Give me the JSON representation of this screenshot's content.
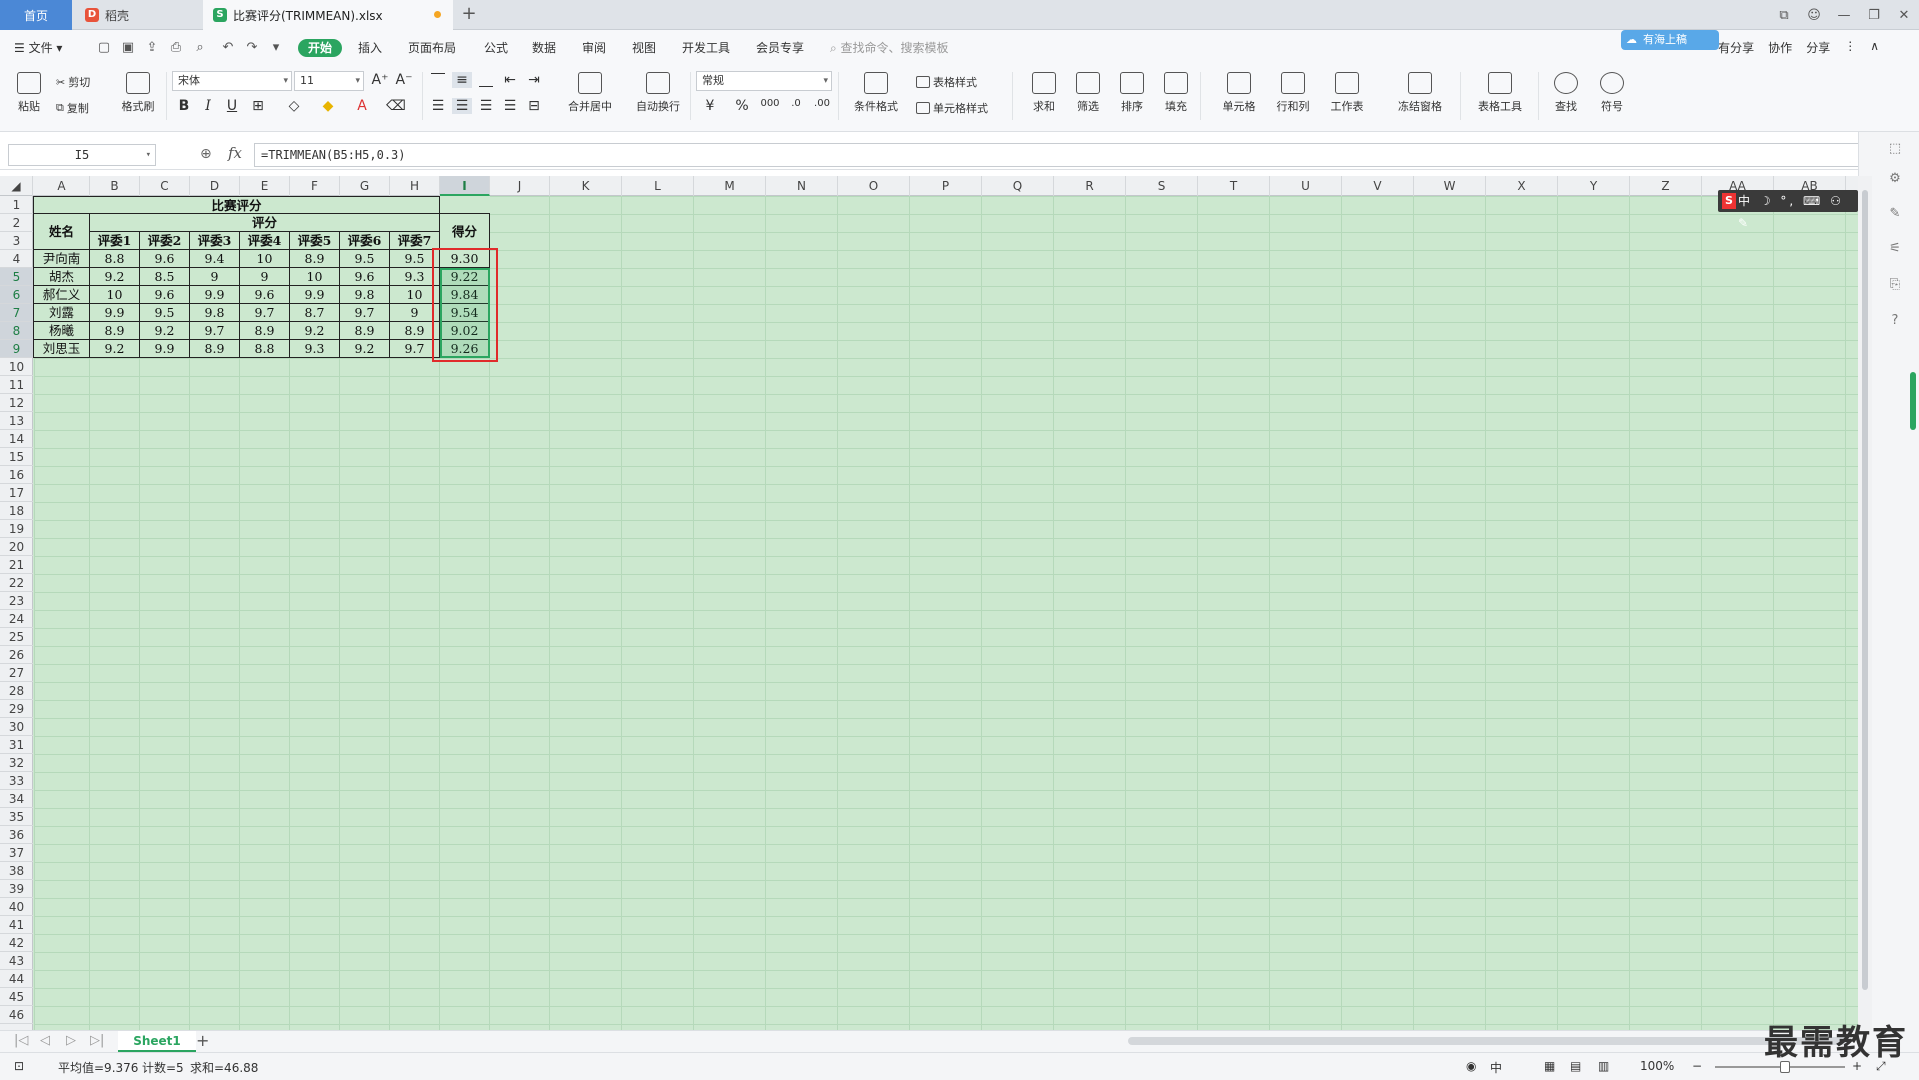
{
  "tabs": {
    "home": "首页",
    "docer": "稻壳",
    "file": "比赛评分(TRIMMEAN).xlsx"
  },
  "menu": {
    "file": "文件",
    "items": [
      "开始",
      "插入",
      "页面布局",
      "公式",
      "数据",
      "审阅",
      "视图",
      "开发工具",
      "会员专享"
    ],
    "search_placeholder": "查找命令、搜索模板",
    "cloud_badge": "有海上稿",
    "right": [
      "有分享",
      "协作",
      "分享"
    ]
  },
  "ribbon": {
    "paste": "粘贴",
    "cut": "剪切",
    "copy": "复制",
    "format_painter": "格式刷",
    "font_name": "宋体",
    "font_size": "11",
    "merge_center": "合并居中",
    "wrap_text": "自动换行",
    "number_format": "常规",
    "cond_format": "条件格式",
    "table_style": "表格样式",
    "cell_style": "单元格样式",
    "sum": "求和",
    "filter": "筛选",
    "sort": "排序",
    "fill": "填充",
    "cell": "单元格",
    "row_col": "行和列",
    "worksheet": "工作表",
    "freeze": "冻结窗格",
    "table_tools": "表格工具",
    "find": "查找",
    "symbol": "符号"
  },
  "formula_bar": {
    "cell_ref": "I5",
    "fx": "fx",
    "formula": "=TRIMMEAN(B5:H5,0.3)"
  },
  "columns": [
    "A",
    "B",
    "C",
    "D",
    "E",
    "F",
    "G",
    "H",
    "I",
    "J",
    "K",
    "L",
    "M",
    "N",
    "O",
    "P",
    "Q",
    "R",
    "S",
    "T",
    "U",
    "V",
    "W",
    "X",
    "Y",
    "Z",
    "AA",
    "AB"
  ],
  "sheet": {
    "title": "比赛评分",
    "name_header": "姓名",
    "score_group": "评分",
    "result_header": "得分",
    "judges": [
      "评委1",
      "评委2",
      "评委3",
      "评委4",
      "评委5",
      "评委6",
      "评委7"
    ],
    "rows": [
      {
        "name": "尹向南",
        "scores": [
          "8.8",
          "9.6",
          "9.4",
          "10",
          "8.9",
          "9.5",
          "9.5"
        ],
        "result": "9.30"
      },
      {
        "name": "胡杰",
        "scores": [
          "9.2",
          "8.5",
          "9",
          "9",
          "10",
          "9.6",
          "9.3"
        ],
        "result": "9.22"
      },
      {
        "name": "郝仁义",
        "scores": [
          "10",
          "9.6",
          "9.9",
          "9.6",
          "9.9",
          "9.8",
          "10"
        ],
        "result": "9.84"
      },
      {
        "name": "刘露",
        "scores": [
          "9.9",
          "9.5",
          "9.8",
          "9.7",
          "8.7",
          "9.7",
          "9"
        ],
        "result": "9.54"
      },
      {
        "name": "杨曦",
        "scores": [
          "8.9",
          "9.2",
          "9.7",
          "8.9",
          "9.2",
          "8.9",
          "8.9"
        ],
        "result": "9.02"
      },
      {
        "name": "刘思玉",
        "scores": [
          "9.2",
          "9.9",
          "8.9",
          "8.8",
          "9.3",
          "9.2",
          "9.7"
        ],
        "result": "9.26"
      }
    ]
  },
  "ime": "中 ☽ °, ⌨ ⚇ ✎",
  "sheet_tabs": {
    "active": "Sheet1",
    "add": "+"
  },
  "status": {
    "average": "平均值=9.376",
    "count": "计数=5",
    "sum": "求和=46.88",
    "zoom": "100%",
    "lang": "中"
  },
  "watermark": "最需教育",
  "colors": {
    "accent": "#2ba560",
    "grid_bg": "#cce8cf",
    "highlight_box": "#e02b2b"
  }
}
